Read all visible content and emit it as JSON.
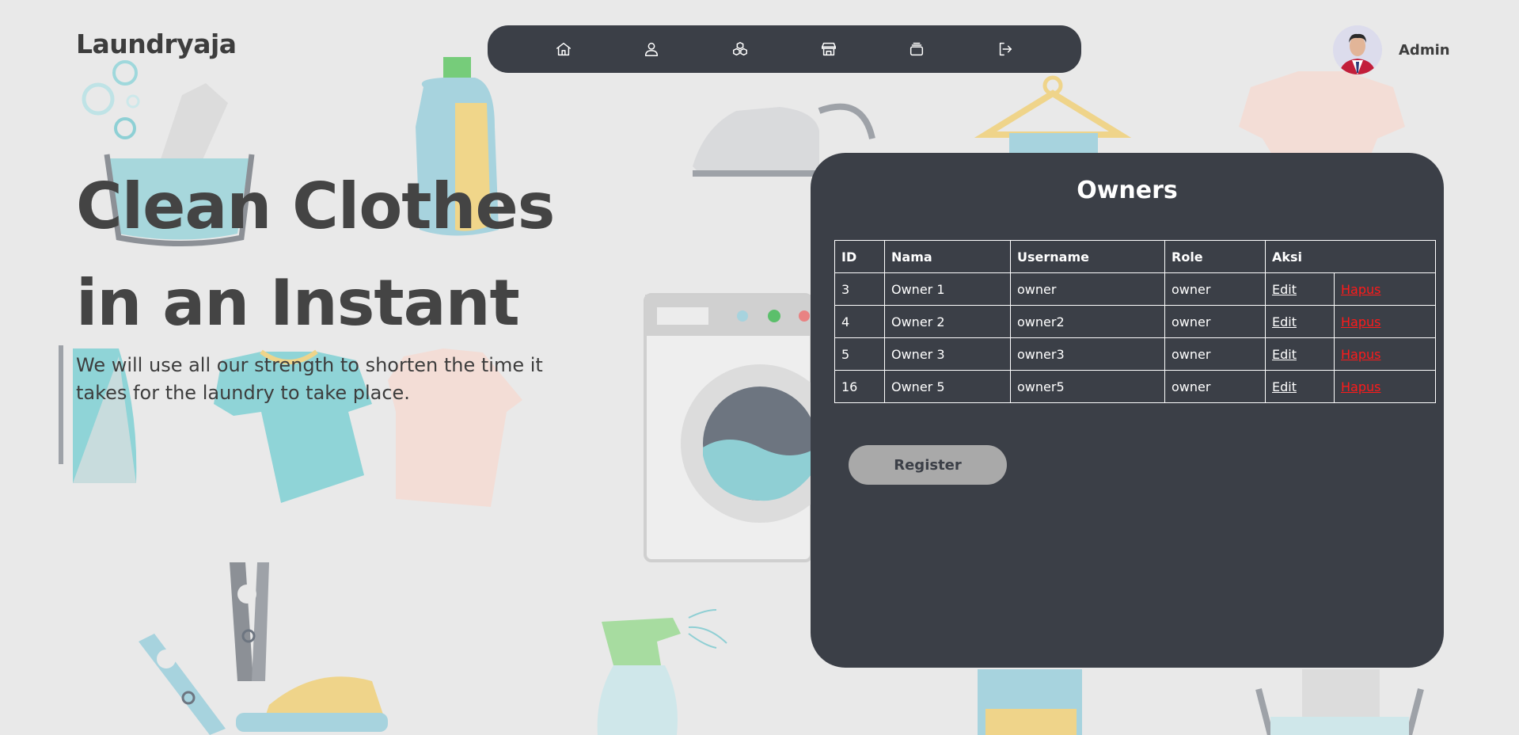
{
  "brand": {
    "name": "Laundryaja"
  },
  "nav": {
    "items": [
      {
        "icon": "home-icon"
      },
      {
        "icon": "user-icon"
      },
      {
        "icon": "boxes-icon"
      },
      {
        "icon": "store-icon"
      },
      {
        "icon": "layers-icon"
      },
      {
        "icon": "logout-icon"
      }
    ]
  },
  "profile": {
    "name": "Admin",
    "avatar": "avatar"
  },
  "hero": {
    "title_line1": "Clean Clothes",
    "title_line2": "in an Instant",
    "subtitle": "We will use all our strength to shorten the time it takes for the laundry to take place."
  },
  "owners": {
    "title": "Owners",
    "columns": [
      "ID",
      "Nama",
      "Username",
      "Role",
      "Aksi"
    ],
    "rows": [
      {
        "id": "3",
        "nama": "Owner 1",
        "username": "owner",
        "role": "owner",
        "edit": "Edit",
        "hapus": "Hapus"
      },
      {
        "id": "4",
        "nama": "Owner 2",
        "username": "owner2",
        "role": "owner",
        "edit": "Edit",
        "hapus": "Hapus"
      },
      {
        "id": "5",
        "nama": "Owner 3",
        "username": "owner3",
        "role": "owner",
        "edit": "Edit",
        "hapus": "Hapus"
      },
      {
        "id": "16",
        "nama": "Owner 5",
        "username": "owner5",
        "role": "owner",
        "edit": "Edit",
        "hapus": "Hapus"
      }
    ],
    "register_label": "Register"
  },
  "colors": {
    "background": "#e9e9e9",
    "panel": "#3b3f47",
    "delete_link": "#ff1a1a",
    "register_button": "#a9a9a9"
  }
}
